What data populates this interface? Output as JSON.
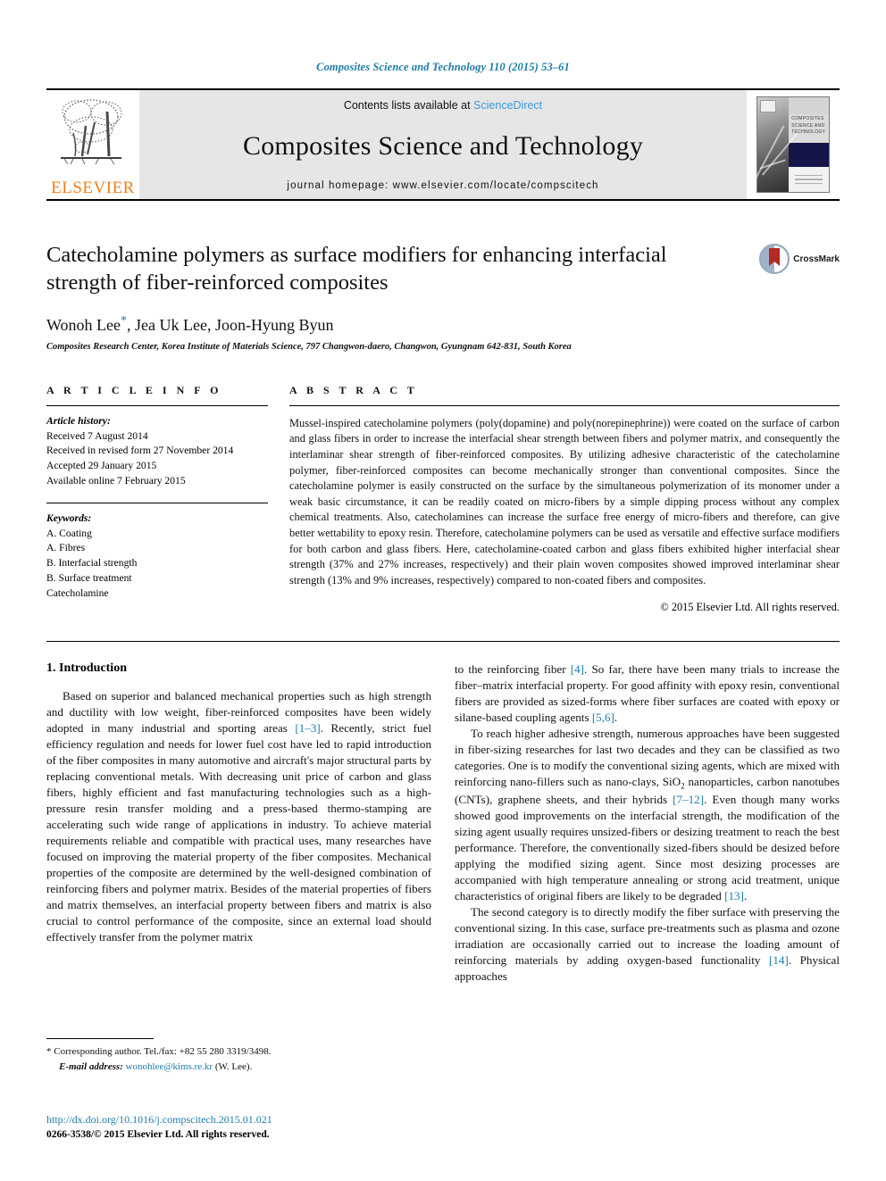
{
  "running_head": "Composites Science and Technology 110 (2015) 53–61",
  "masthead": {
    "publisher_name": "ELSEVIER",
    "contents_prefix": "Contents lists available at",
    "sciencedirect": "ScienceDirect",
    "journal_title": "Composites Science and Technology",
    "homepage": "journal homepage: www.elsevier.com/locate/compscitech",
    "cover_title": "COMPOSITES SCIENCE AND TECHNOLOGY"
  },
  "article": {
    "title": "Catecholamine polymers as surface modifiers for enhancing interfacial strength of fiber-reinforced composites",
    "authors": "Wonoh Lee",
    "authors_rest": ", Jea Uk Lee, Joon-Hyung Byun",
    "corresponding_marker": "*",
    "affiliation": "Composites Research Center, Korea Institute of Materials Science, 797 Changwon-daero, Changwon, Gyungnam 642-831, South Korea",
    "crossmark_label": "CrossMark"
  },
  "article_info": {
    "heading": "A R T I C L E   I N F O",
    "history_label": "Article history:",
    "history": [
      "Received 7 August 2014",
      "Received in revised form 27 November 2014",
      "Accepted 29 January 2015",
      "Available online 7 February 2015"
    ],
    "keywords_label": "Keywords:",
    "keywords": [
      "A. Coating",
      "A. Fibres",
      "B. Interfacial strength",
      "B. Surface treatment",
      "Catecholamine"
    ]
  },
  "abstract": {
    "heading": "A B S T R A C T",
    "text": "Mussel-inspired catecholamine polymers (poly(dopamine) and poly(norepinephrine)) were coated on the surface of carbon and glass fibers in order to increase the interfacial shear strength between fibers and polymer matrix, and consequently the interlaminar shear strength of fiber-reinforced composites. By utilizing adhesive characteristic of the catecholamine polymer, fiber-reinforced composites can become mechanically stronger than conventional composites. Since the catecholamine polymer is easily constructed on the surface by the simultaneous polymerization of its monomer under a weak basic circumstance, it can be readily coated on micro-fibers by a simple dipping process without any complex chemical treatments. Also, catecholamines can increase the surface free energy of micro-fibers and therefore, can give better wettability to epoxy resin. Therefore, catecholamine polymers can be used as versatile and effective surface modifiers for both carbon and glass fibers. Here, catecholamine-coated carbon and glass fibers exhibited higher interfacial shear strength (37% and 27% increases, respectively) and their plain woven composites showed improved interlaminar shear strength (13% and 9% increases, respectively) compared to non-coated fibers and composites.",
    "copyright": "© 2015 Elsevier Ltd. All rights reserved."
  },
  "body": {
    "section_heading": "1. Introduction",
    "left_p1_a": "Based on superior and balanced mechanical properties such as high strength and ductility with low weight, fiber-reinforced composites have been widely adopted in many industrial and sporting areas ",
    "left_p1_cite1": "[1–3]",
    "left_p1_b": ". Recently, strict fuel efficiency regulation and needs for lower fuel cost have led to rapid introduction of the fiber composites in many automotive and aircraft's major structural parts by replacing conventional metals. With decreasing unit price of carbon and glass fibers, highly efficient and fast manufacturing technologies such as a high-pressure resin transfer molding and a press-based thermo-stamping are accelerating such wide range of applications in industry. To achieve material requirements reliable and compatible with practical uses, many researches have focused on improving the material property of the fiber composites. Mechanical properties of the composite are determined by the well-designed combination of reinforcing fibers and polymer matrix. Besides of the material properties of fibers and matrix themselves, an interfacial property between fibers and matrix is also crucial to control performance of the composite, since an external load should effectively transfer from the polymer matrix",
    "right_p1_a": "to the reinforcing fiber ",
    "right_p1_cite1": "[4]",
    "right_p1_b": ". So far, there have been many trials to increase the fiber–matrix interfacial property. For good affinity with epoxy resin, conventional fibers are provided as sized-forms where fiber surfaces are coated with epoxy or silane-based coupling agents ",
    "right_p1_cite2": "[5,6]",
    "right_p1_c": ".",
    "right_p2_a": "To reach higher adhesive strength, numerous approaches have been suggested in fiber-sizing researches for last two decades and they can be classified as two categories. One is to modify the conventional sizing agents, which are mixed with reinforcing nano-fillers such as nano-clays, SiO",
    "right_p2_sub": "2",
    "right_p2_b": " nanoparticles, carbon nanotubes (CNTs), graphene sheets, and their hybrids ",
    "right_p2_cite1": "[7–12]",
    "right_p2_c": ". Even though many works showed good improvements on the interfacial strength, the modification of the sizing agent usually requires unsized-fibers or desizing treatment to reach the best performance. Therefore, the conventionally sized-fibers should be desized before applying the modified sizing agent. Since most desizing processes are accompanied with high temperature annealing or strong acid treatment, unique characteristics of original fibers are likely to be degraded ",
    "right_p2_cite2": "[13]",
    "right_p2_d": ".",
    "right_p3_a": "The second category is to directly modify the fiber surface with preserving the conventional sizing. In this case, surface pre-treatments such as plasma and ozone irradiation are occasionally carried out to increase the loading amount of reinforcing materials by adding oxygen-based functionality ",
    "right_p3_cite1": "[14]",
    "right_p3_b": ". Physical approaches"
  },
  "footnotes": {
    "corresponding_star": "*",
    "corresponding_text": "Corresponding author. Tel./fax: +82 55 280 3319/3498.",
    "email_label": "E-mail address:",
    "email": "wonohlee@kims.re.kr",
    "email_suffix": "(W. Lee).",
    "doi": "http://dx.doi.org/10.1016/j.compscitech.2015.01.021",
    "issn": "0266-3538/© 2015 Elsevier Ltd. All rights reserved."
  },
  "colors": {
    "link_blue": "#1b7ca8",
    "sciencedirect_blue": "#3a9ad9",
    "elsevier_orange": "#f07f1a",
    "crossmark_red": "#b32b21"
  }
}
